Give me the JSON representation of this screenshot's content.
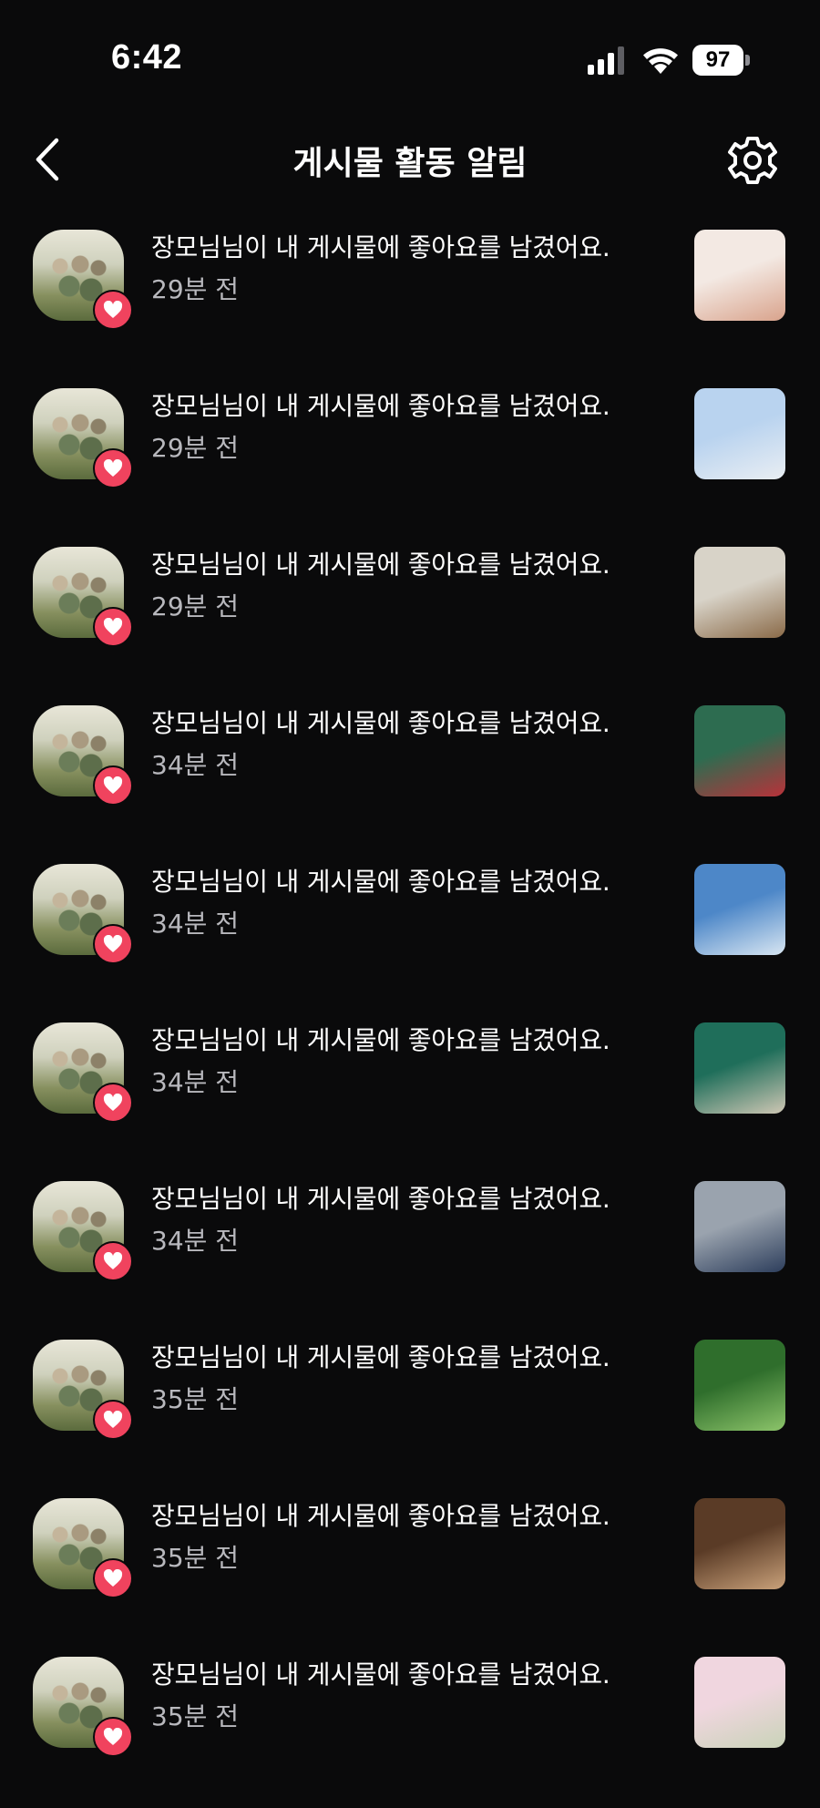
{
  "status_bar": {
    "time": "6:42",
    "battery": "97"
  },
  "header": {
    "title": "게시물 활동 알림"
  },
  "notifications": [
    {
      "message": "장모님님이 내 게시물에 좋아요를 남겼어요.",
      "time": "29분 전",
      "thumb_colors": [
        "#f3e9e3",
        "#d9a38c"
      ]
    },
    {
      "message": "장모님님이 내 게시물에 좋아요를 남겼어요.",
      "time": "29분 전",
      "thumb_colors": [
        "#b9d3ef",
        "#e9eef3"
      ]
    },
    {
      "message": "장모님님이 내 게시물에 좋아요를 남겼어요.",
      "time": "29분 전",
      "thumb_colors": [
        "#d8d3c8",
        "#8a6a48"
      ]
    },
    {
      "message": "장모님님이 내 게시물에 좋아요를 남겼어요.",
      "time": "34분 전",
      "thumb_colors": [
        "#2d6c50",
        "#b8323a"
      ]
    },
    {
      "message": "장모님님이 내 게시물에 좋아요를 남겼어요.",
      "time": "34분 전",
      "thumb_colors": [
        "#4d87c8",
        "#d8e6f2"
      ]
    },
    {
      "message": "장모님님이 내 게시물에 좋아요를 남겼어요.",
      "time": "34분 전",
      "thumb_colors": [
        "#1f6e5a",
        "#cfc7b4"
      ]
    },
    {
      "message": "장모님님이 내 게시물에 좋아요를 남겼어요.",
      "time": "34분 전",
      "thumb_colors": [
        "#9aa3ae",
        "#2d3e5c"
      ]
    },
    {
      "message": "장모님님이 내 게시물에 좋아요를 남겼어요.",
      "time": "35분 전",
      "thumb_colors": [
        "#2f6e2c",
        "#8cc46a"
      ]
    },
    {
      "message": "장모님님이 내 게시물에 좋아요를 남겼어요.",
      "time": "35분 전",
      "thumb_colors": [
        "#5a3b26",
        "#c9a17a"
      ]
    },
    {
      "message": "장모님님이 내 게시물에 좋아요를 남겼어요.",
      "time": "35분 전",
      "thumb_colors": [
        "#f0d6df",
        "#c9d3b8"
      ]
    }
  ],
  "colors": {
    "background": "#0a0a0b",
    "heart_badge": "#f0435e",
    "secondary_text": "#b8b8bd"
  }
}
